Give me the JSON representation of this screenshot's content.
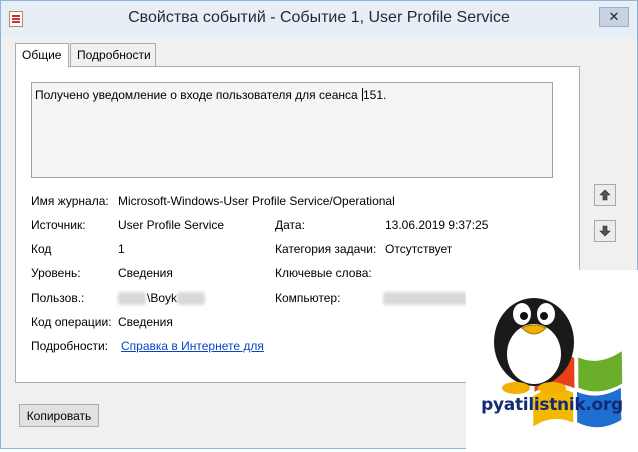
{
  "window": {
    "title": "Свойства событий - Событие 1, User Profile Service",
    "close_glyph": "✕"
  },
  "tabs": [
    {
      "label": "Общие",
      "active": true
    },
    {
      "label": "Подробности",
      "active": false
    }
  ],
  "description": {
    "before_caret": "Получено уведомление о входе пользователя для сеанса ",
    "after_caret": "151."
  },
  "fields": {
    "log_name": {
      "label": "Имя журнала:",
      "value": "Microsoft-Windows-User Profile Service/Operational"
    },
    "source": {
      "label": "Источник:",
      "value": "User Profile Service"
    },
    "date": {
      "label": "Дата:",
      "value": "13.06.2019 9:37:25"
    },
    "code": {
      "label": "Код",
      "value": "1"
    },
    "task_category": {
      "label": "Категория задачи:",
      "value": "Отсутствует"
    },
    "level": {
      "label": "Уровень:",
      "value": "Сведения"
    },
    "keywords": {
      "label": "Ключевые слова:",
      "value": ""
    },
    "user": {
      "label": "Пользов.:",
      "value_visible": "\\Boyk"
    },
    "computer": {
      "label": "Компьютер:",
      "value": ""
    },
    "opcode": {
      "label": "Код операции:",
      "value": "Сведения"
    },
    "details": {
      "label": "Подробности:",
      "link_text": "Справка в Интернете для"
    }
  },
  "nav": {
    "up_icon": "arrow-up-icon",
    "down_icon": "arrow-down-icon"
  },
  "buttons": {
    "copy": "Копировать"
  },
  "watermark": {
    "text": "pyatilistnik.org"
  },
  "colors": {
    "title_bg": "#e8eef6",
    "link": "#0b44c2",
    "win_red": "#e8411a",
    "win_green": "#6aae2c",
    "win_blue": "#1e6fd0",
    "win_yellow": "#f5b800"
  }
}
